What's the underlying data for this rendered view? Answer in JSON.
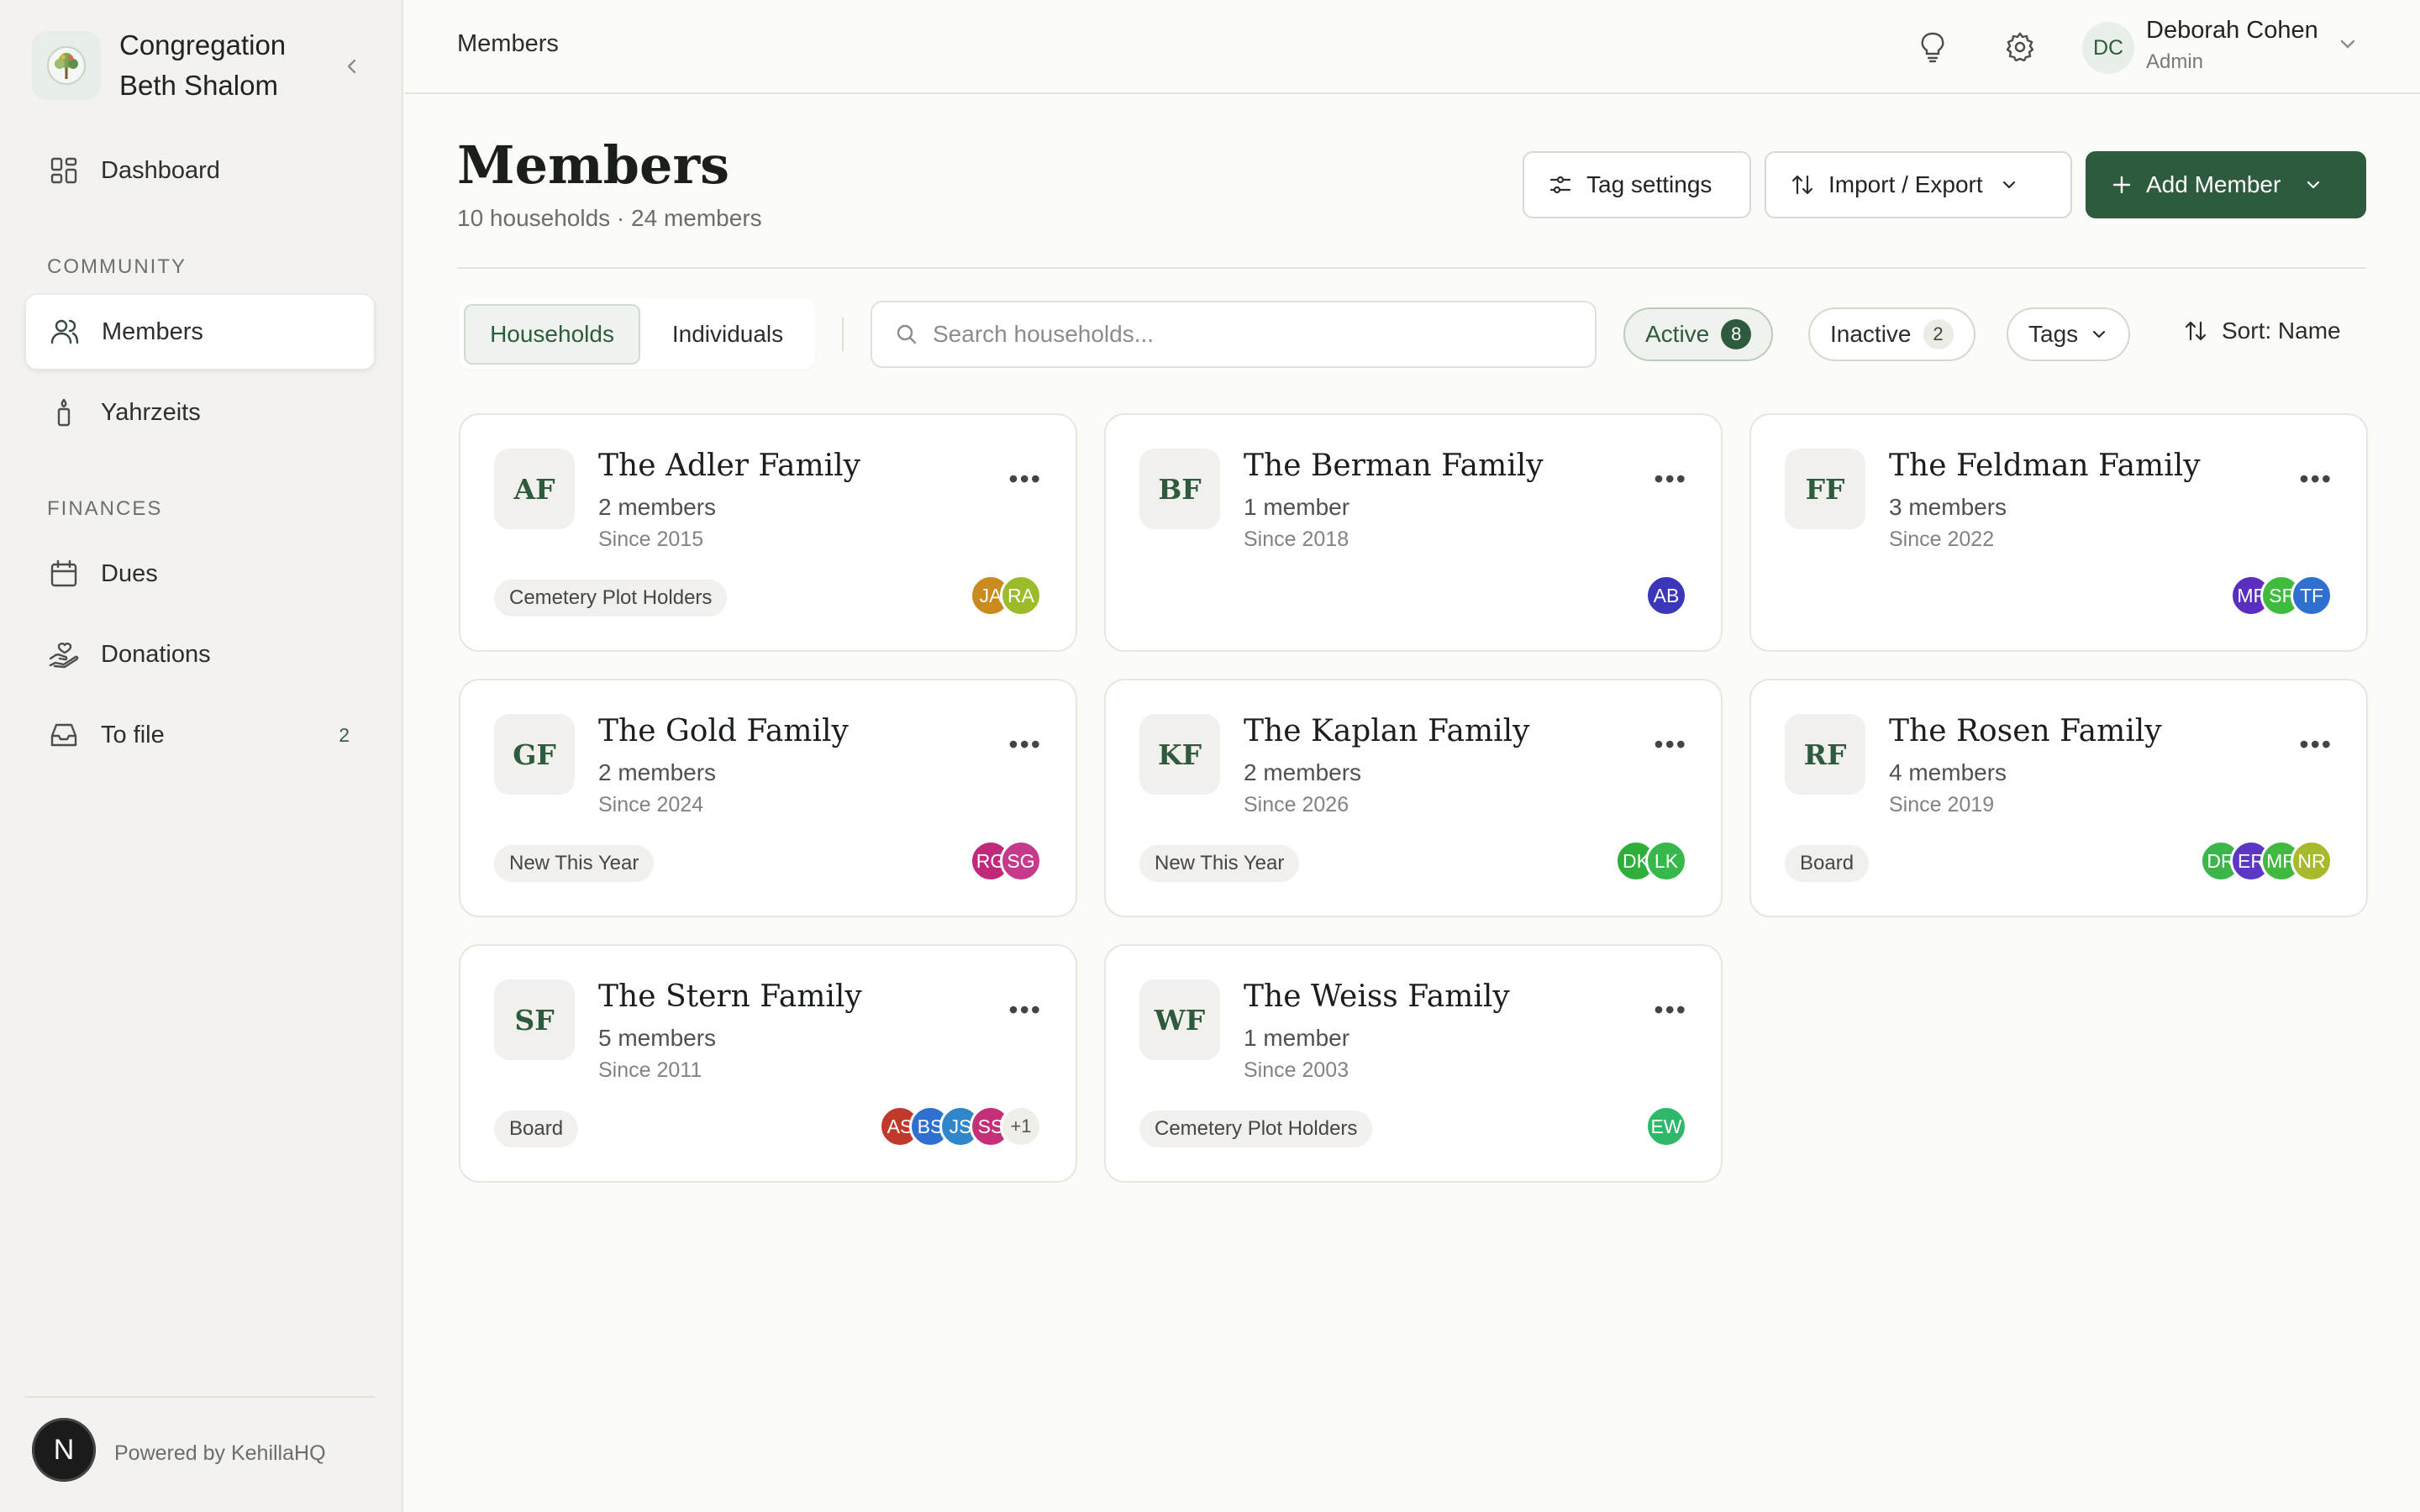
{
  "sidebar": {
    "org_line1": "Congregation",
    "org_line2": "Beth Shalom",
    "nav_dashboard": "Dashboard",
    "section_community": "COMMUNITY",
    "nav_members": "Members",
    "nav_yahrzeits": "Yahrzeits",
    "section_finances": "FINANCES",
    "nav_dues": "Dues",
    "nav_donations": "Donations",
    "nav_tofile": "To file",
    "nav_tofile_count": "2",
    "powered": "Powered by KehillaHQ",
    "n_button": "N"
  },
  "topbar": {
    "breadcrumb": "Members",
    "user_initials": "DC",
    "user_name": "Deborah Cohen",
    "user_role": "Admin"
  },
  "header": {
    "title": "Members",
    "subtitle": "10 households · 24 members",
    "tag_settings": "Tag settings",
    "import_export": "Import / Export",
    "add_member": "Add Member"
  },
  "filters": {
    "tab_households": "Households",
    "tab_individuals": "Individuals",
    "search_placeholder": "Search households...",
    "active_label": "Active",
    "active_count": "8",
    "inactive_label": "Inactive",
    "inactive_count": "2",
    "tags_label": "Tags",
    "sort_label": "Sort: Name"
  },
  "colors": {
    "accent": "#2e5a3d"
  },
  "households": [
    {
      "initials": "AF",
      "name": "The Adler Family",
      "members": "2 members",
      "since": "Since 2015",
      "tag": "Cemetery Plot Holders",
      "avatars": [
        {
          "t": "JA",
          "c": "#c98a1e"
        },
        {
          "t": "RA",
          "c": "#9bbb2a"
        }
      ],
      "extra": ""
    },
    {
      "initials": "BF",
      "name": "The Berman Family",
      "members": "1 member",
      "since": "Since 2018",
      "tag": "",
      "avatars": [
        {
          "t": "AB",
          "c": "#3b35b8"
        }
      ],
      "extra": ""
    },
    {
      "initials": "FF",
      "name": "The Feldman Family",
      "members": "3 members",
      "since": "Since 2022",
      "tag": "",
      "avatars": [
        {
          "t": "MF",
          "c": "#5a2fc0"
        },
        {
          "t": "SF",
          "c": "#3fbb3d"
        },
        {
          "t": "TF",
          "c": "#2f6fd0"
        }
      ],
      "extra": ""
    },
    {
      "initials": "GF",
      "name": "The Gold Family",
      "members": "2 members",
      "since": "Since 2024",
      "tag": "New This Year",
      "avatars": [
        {
          "t": "RG",
          "c": "#c0297a"
        },
        {
          "t": "SG",
          "c": "#c53a8a"
        }
      ],
      "extra": ""
    },
    {
      "initials": "KF",
      "name": "The Kaplan Family",
      "members": "2 members",
      "since": "Since 2026",
      "tag": "New This Year",
      "avatars": [
        {
          "t": "DK",
          "c": "#2fae3a"
        },
        {
          "t": "LK",
          "c": "#36b84a"
        }
      ],
      "extra": ""
    },
    {
      "initials": "RF",
      "name": "The Rosen Family",
      "members": "4 members",
      "since": "Since 2019",
      "tag": "Board",
      "avatars": [
        {
          "t": "DR",
          "c": "#3cb54a"
        },
        {
          "t": "ER",
          "c": "#5c36c4"
        },
        {
          "t": "MR",
          "c": "#41b83f"
        },
        {
          "t": "NR",
          "c": "#a9b92d"
        }
      ],
      "extra": ""
    },
    {
      "initials": "SF",
      "name": "The Stern Family",
      "members": "5 members",
      "since": "Since 2011",
      "tag": "Board",
      "avatars": [
        {
          "t": "AS",
          "c": "#c0392b"
        },
        {
          "t": "BS",
          "c": "#2e6fd0"
        },
        {
          "t": "JS",
          "c": "#2f86c8"
        },
        {
          "t": "SS",
          "c": "#c42f78"
        }
      ],
      "extra": "+1"
    },
    {
      "initials": "WF",
      "name": "The Weiss Family",
      "members": "1 member",
      "since": "Since 2003",
      "tag": "Cemetery Plot Holders",
      "avatars": [
        {
          "t": "EW",
          "c": "#2fb86a"
        }
      ],
      "extra": ""
    }
  ]
}
